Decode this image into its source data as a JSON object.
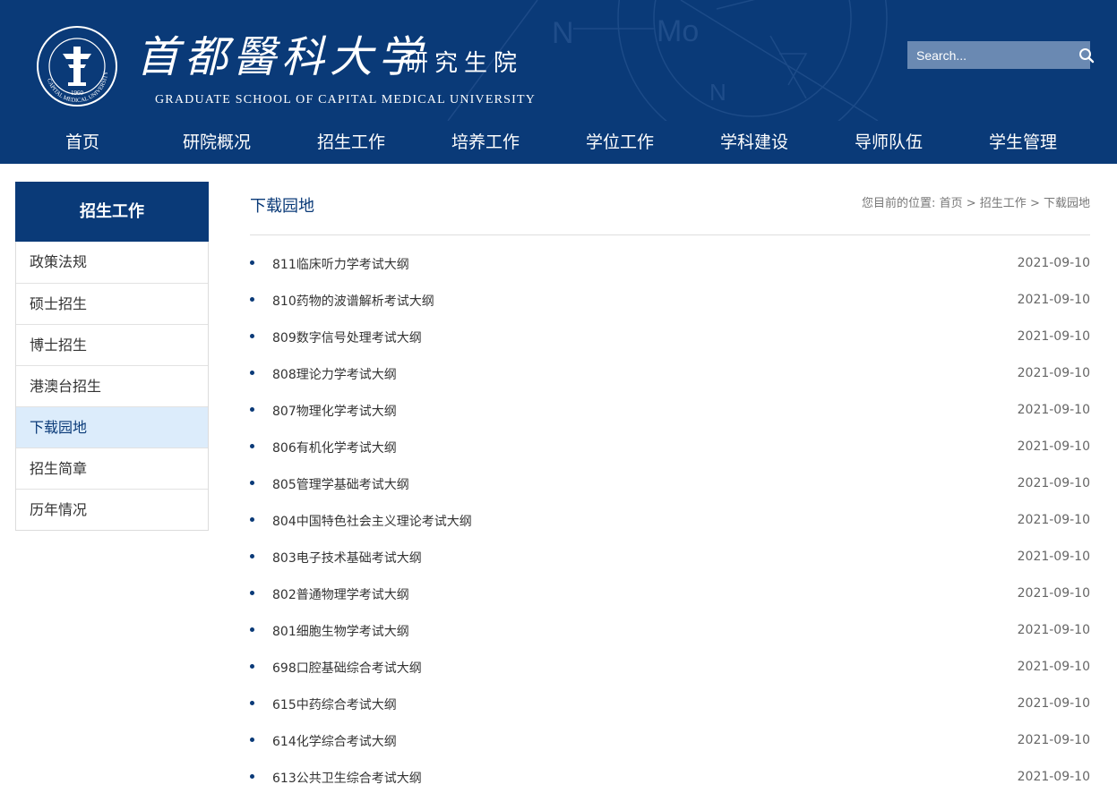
{
  "header": {
    "logo_cn": "首都醫科大学",
    "logo_sub": "研究生院",
    "logo_en": "GRADUATE SCHOOL OF CAPITAL MEDICAL UNIVERSITY",
    "seal_text": "首都醫科大学 · CAPITAL MEDICAL UNIVERSITY · 1960",
    "search_placeholder": "Search..."
  },
  "nav": {
    "items": [
      "首页",
      "研院概况",
      "招生工作",
      "培养工作",
      "学位工作",
      "学科建设",
      "导师队伍",
      "学生管理"
    ]
  },
  "sidebar": {
    "title": "招生工作",
    "items": [
      "政策法规",
      "硕士招生",
      "博士招生",
      "港澳台招生",
      "下载园地",
      "招生简章",
      "历年情况"
    ]
  },
  "main": {
    "heading": "下载园地",
    "breadcrumb": {
      "prefix": "您目前的位置:",
      "home": "首页",
      "sep": ">",
      "section": "招生工作",
      "current": "下载园地"
    },
    "list": [
      {
        "title": "811临床听力学考试大纲",
        "date": "2021-09-10"
      },
      {
        "title": "810药物的波谱解析考试大纲",
        "date": "2021-09-10"
      },
      {
        "title": "809数字信号处理考试大纲",
        "date": "2021-09-10"
      },
      {
        "title": "808理论力学考试大纲",
        "date": "2021-09-10"
      },
      {
        "title": "807物理化学考试大纲",
        "date": "2021-09-10"
      },
      {
        "title": "806有机化学考试大纲",
        "date": "2021-09-10"
      },
      {
        "title": "805管理学基础考试大纲",
        "date": "2021-09-10"
      },
      {
        "title": "804中国特色社会主义理论考试大纲",
        "date": "2021-09-10"
      },
      {
        "title": "803电子技术基础考试大纲",
        "date": "2021-09-10"
      },
      {
        "title": "802普通物理学考试大纲",
        "date": "2021-09-10"
      },
      {
        "title": "801细胞生物学考试大纲",
        "date": "2021-09-10"
      },
      {
        "title": "698口腔基础综合考试大纲",
        "date": "2021-09-10"
      },
      {
        "title": "615中药综合考试大纲",
        "date": "2021-09-10"
      },
      {
        "title": "614化学综合考试大纲",
        "date": "2021-09-10"
      },
      {
        "title": "613公共卫生综合考试大纲",
        "date": "2021-09-10"
      }
    ]
  },
  "colors": {
    "brand": "#0a3a78",
    "active_bg": "#dcecfb",
    "search_bg": "#6a89b2"
  }
}
